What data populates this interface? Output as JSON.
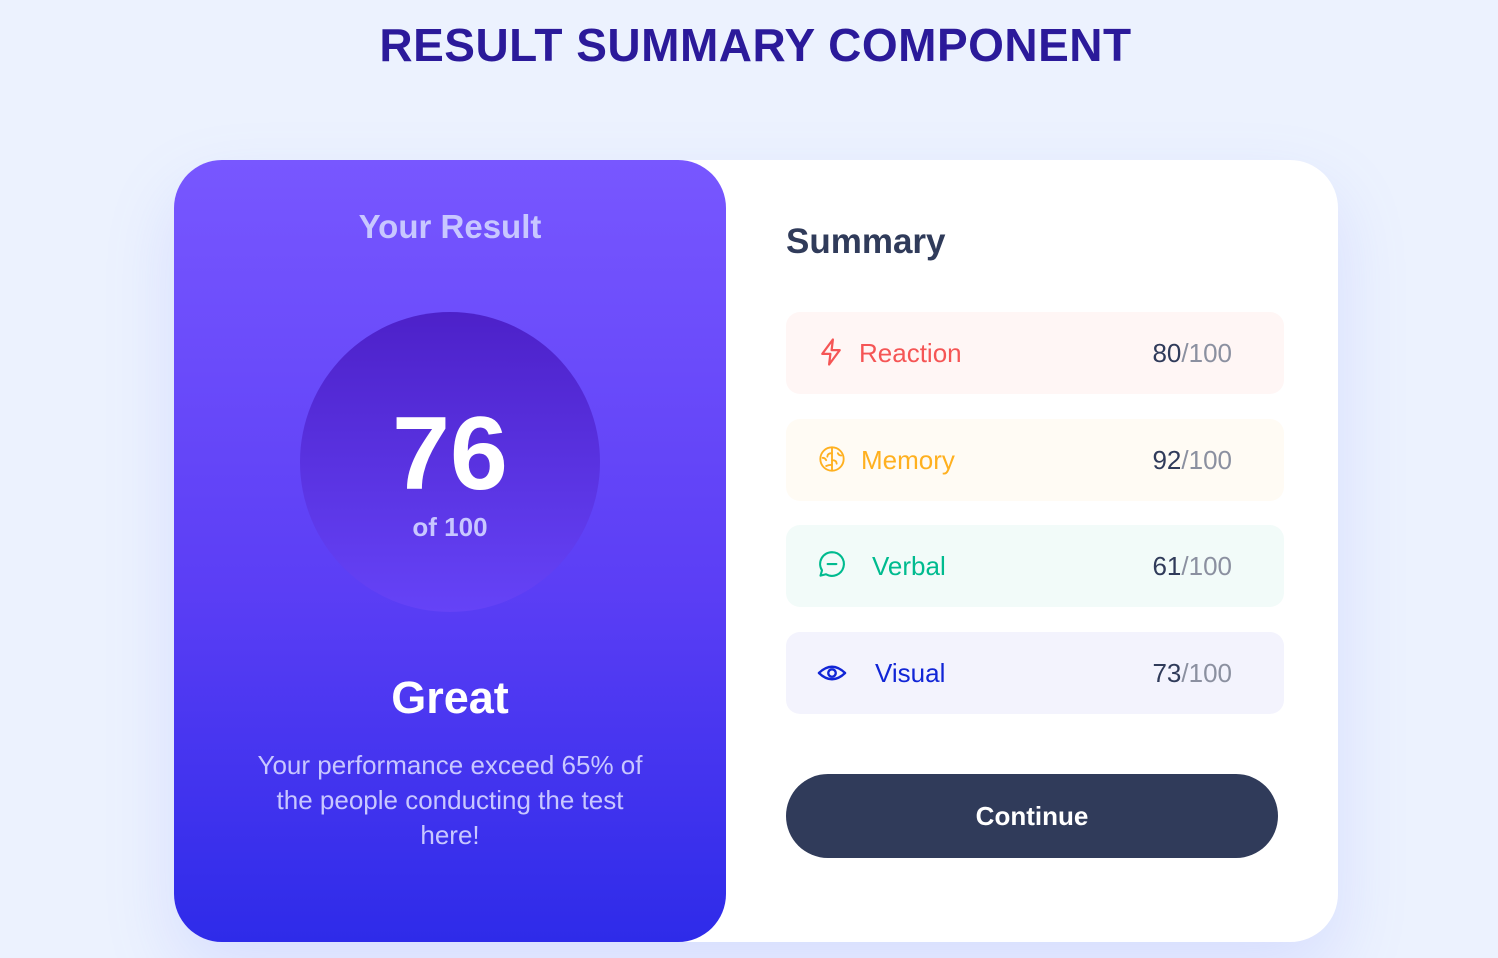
{
  "page": {
    "title": "RESULT SUMMARY COMPONENT"
  },
  "result": {
    "heading": "Your Result",
    "score": "76",
    "out_of": "of 100",
    "rating": "Great",
    "description": "Your performance exceed 65% of the people conducting the test here!"
  },
  "summary": {
    "heading": "Summary",
    "items": [
      {
        "label": "Reaction",
        "score": "80",
        "max": "/100",
        "icon": "lightning-icon",
        "color": "#f55555",
        "bg": "#fff6f5"
      },
      {
        "label": "Memory",
        "score": "92",
        "max": "/100",
        "icon": "brain-icon",
        "color": "#ffb01f",
        "bg": "#fffbf4"
      },
      {
        "label": "Verbal",
        "score": "61",
        "max": "/100",
        "icon": "chat-bubble-icon",
        "color": "#00bb8f",
        "bg": "#f2fbf9"
      },
      {
        "label": "Visual",
        "score": "73",
        "max": "/100",
        "icon": "eye-icon",
        "color": "#1125d6",
        "bg": "#f3f3fd"
      }
    ],
    "continue_label": "Continue"
  }
}
